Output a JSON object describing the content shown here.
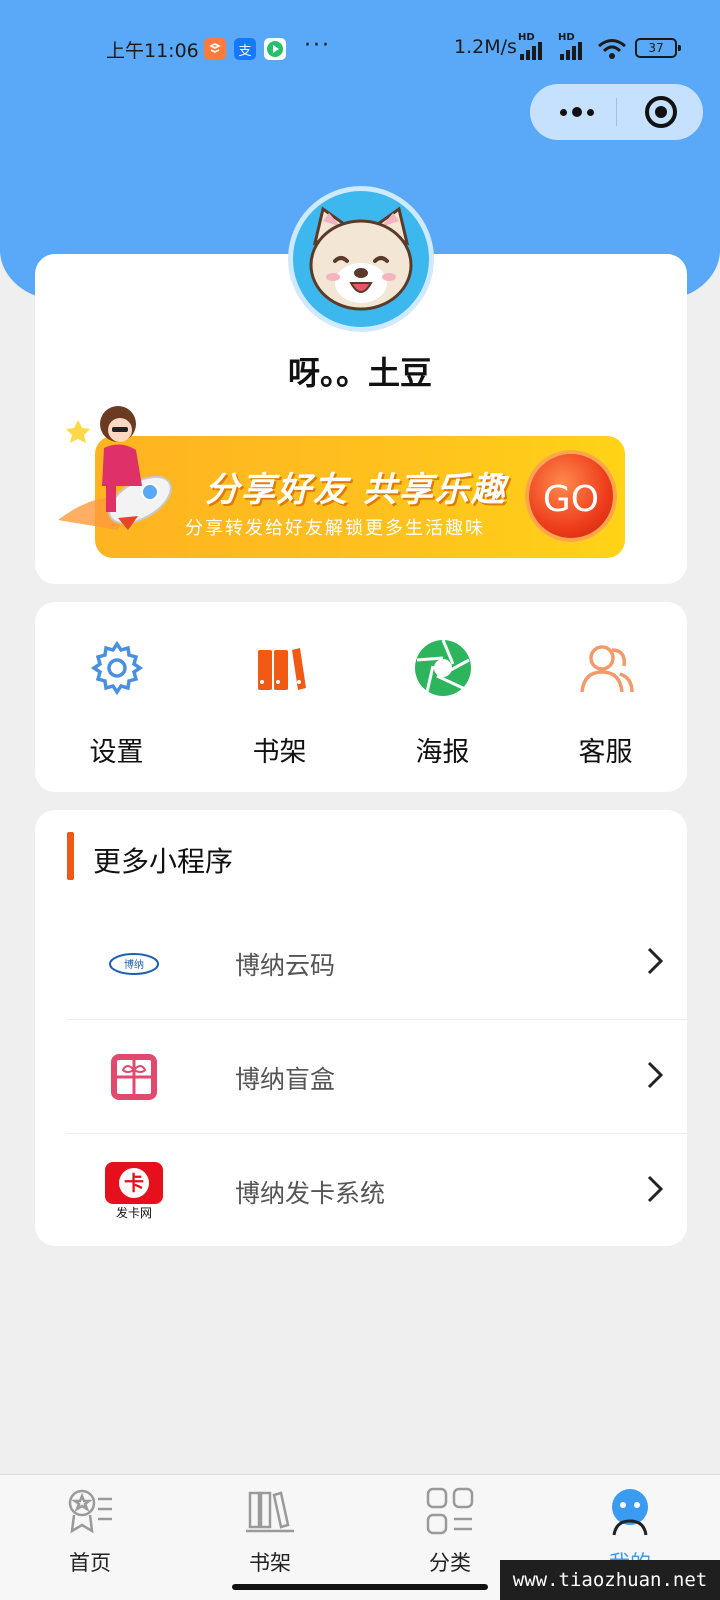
{
  "status_bar": {
    "time": "上午11:06",
    "app_icon_2": "支",
    "more": "···",
    "speed": "1.2M/s",
    "signal_1": "HD",
    "signal_2": "HD",
    "battery": "37"
  },
  "profile": {
    "username": "呀。。土豆"
  },
  "banner": {
    "title": "分享好友 共享乐趣",
    "subtitle": "分享转发给好友解锁更多生活趣味",
    "go": "GO"
  },
  "menu": [
    {
      "label": "设置",
      "icon": "gear-icon",
      "color": "#4a90e2"
    },
    {
      "label": "书架",
      "icon": "bookshelf-icon",
      "color": "#f05a14"
    },
    {
      "label": "海报",
      "icon": "aperture-icon",
      "color": "#2db55d"
    },
    {
      "label": "客服",
      "icon": "customer-service-icon",
      "color": "#f39a6a"
    }
  ],
  "mini_programs": {
    "title": "更多小程序",
    "items": [
      {
        "label": "博纳云码",
        "icon": "bona-yunma-logo"
      },
      {
        "label": "博纳盲盒",
        "icon": "gift-box-icon"
      },
      {
        "label": "博纳发卡系统",
        "icon": "card-logo",
        "logo_text": "卡",
        "logo_caption": "发卡网"
      }
    ]
  },
  "tabbar": [
    {
      "label": "首页",
      "icon": "home-icon"
    },
    {
      "label": "书架",
      "icon": "books-icon"
    },
    {
      "label": "分类",
      "icon": "category-icon"
    },
    {
      "label": "我的",
      "icon": "profile-icon"
    }
  ],
  "watermark": "www.tiaozhuan.net",
  "colors": {
    "header_blue": "#5aa8f8",
    "active_tab": "#3a9bf0",
    "accent_orange": "#ee5a16",
    "banner_yellow": "#ffc21e"
  }
}
